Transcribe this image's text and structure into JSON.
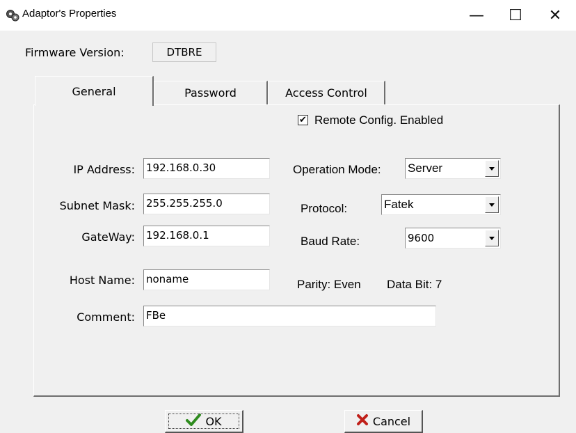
{
  "window": {
    "title": "Adaptor's Properties",
    "icon": "gear-icon",
    "controls": {
      "minimize": "—",
      "maximize": "☐",
      "close": "✕"
    }
  },
  "firmware": {
    "label": "Firmware Version:",
    "value": "DTBRE"
  },
  "tabs": [
    {
      "label": "General",
      "active": true
    },
    {
      "label": "Password",
      "active": false
    },
    {
      "label": "Access Control",
      "active": false
    }
  ],
  "general": {
    "remote_config": {
      "label": "Remote Config. Enabled",
      "checked": true,
      "mark": "✔"
    },
    "ip_address": {
      "label": "IP Address:",
      "value": "192.168.0.30"
    },
    "subnet_mask": {
      "label": "Subnet Mask:",
      "value": "255.255.255.0"
    },
    "gateway": {
      "label": "GateWay:",
      "value": "192.168.0.1"
    },
    "host_name": {
      "label": "Host Name:",
      "value": "noname"
    },
    "comment": {
      "label": "Comment:",
      "value": "FBe"
    },
    "operation_mode": {
      "label": "Operation Mode:",
      "value": "Server"
    },
    "protocol": {
      "label": "Protocol:",
      "value": "Fatek"
    },
    "baud_rate": {
      "label": "Baud Rate:",
      "value": "9600"
    },
    "parity": "Parity: Even",
    "data_bit": "Data Bit: 7"
  },
  "buttons": {
    "ok": {
      "label": "OK",
      "icon": "checkmark-icon",
      "color": "#2e8b1e"
    },
    "cancel": {
      "label": "Cancel",
      "icon": "x-icon",
      "color": "#c0201a"
    }
  }
}
